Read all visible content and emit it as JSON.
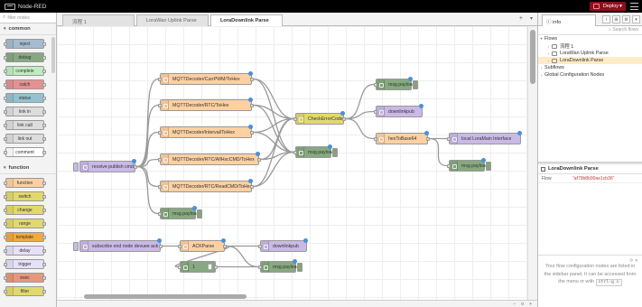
{
  "header": {
    "title": "Node-RED",
    "deploy_label": "Deploy"
  },
  "palette": {
    "filter_placeholder": "filter nodes",
    "categories": [
      {
        "label": "common",
        "nodes": [
          {
            "label": "inject",
            "color": "#a6bbcf"
          },
          {
            "label": "debug",
            "color": "#87a980"
          },
          {
            "label": "complete",
            "color": "#c0edc0"
          },
          {
            "label": "catch",
            "color": "#e49191"
          },
          {
            "label": "status",
            "color": "#94c1d0"
          },
          {
            "label": "link in",
            "color": "#dddddd"
          },
          {
            "label": "link call",
            "color": "#dddddd"
          },
          {
            "label": "link out",
            "color": "#dddddd"
          },
          {
            "label": "comment",
            "color": "#ffffff"
          }
        ]
      },
      {
        "label": "function",
        "nodes": [
          {
            "label": "function",
            "color": "#fdd0a2"
          },
          {
            "label": "switch",
            "color": "#e2d96e"
          },
          {
            "label": "change",
            "color": "#e2d96e"
          },
          {
            "label": "range",
            "color": "#e2d96e"
          },
          {
            "label": "template",
            "color": "#f2a93f"
          },
          {
            "label": "delay",
            "color": "#e6e0f8"
          },
          {
            "label": "trigger",
            "color": "#e6e0f8"
          },
          {
            "label": "exec",
            "color": "#e9967a"
          },
          {
            "label": "filter",
            "color": "#e2d96e"
          }
        ]
      }
    ]
  },
  "workspace": {
    "tabs": [
      {
        "label": "流程 1",
        "active": false
      },
      {
        "label": "LoraWan Uplink Parse",
        "active": false
      },
      {
        "label": "LoraDownlink Parse",
        "active": true
      }
    ],
    "nodes": [
      {
        "id": "recv",
        "label": "receive publish cmd",
        "color": "#c9b9e6"
      },
      {
        "id": "f1",
        "label": "MQTTDecoder/CurrPWM/ToHex",
        "color": "#fdd0a2"
      },
      {
        "id": "f2",
        "label": "MQTTDecoder/RTC/ToHex",
        "color": "#fdd0a2"
      },
      {
        "id": "f3",
        "label": "MQTTDecoder/Interval/ToHex",
        "color": "#fdd0a2"
      },
      {
        "id": "f4",
        "label": "MQTTDecoder/RTC/AlfHscCMD/ToHex",
        "color": "#fdd0a2"
      },
      {
        "id": "f5",
        "label": "MQTTDecoder/RTC/ReadCMD/ToHex",
        "color": "#fdd0a2"
      },
      {
        "id": "dbg1",
        "label": "msg.payload",
        "color": "#87a980"
      },
      {
        "id": "check",
        "label": "CheckErrorCode",
        "color": "#e2d96e"
      },
      {
        "id": "dbg2",
        "label": "msg.payload",
        "color": "#87a980"
      },
      {
        "id": "dbg3",
        "label": "msg.payload",
        "color": "#87a980"
      },
      {
        "id": "down",
        "label": "downlinkpub",
        "color": "#c9b9e6"
      },
      {
        "id": "hex",
        "label": "hexToBase64",
        "color": "#fdd0a2"
      },
      {
        "id": "local",
        "label": "local LoraMain Interface",
        "color": "#c9b9e6"
      },
      {
        "id": "dbg4",
        "label": "msg.payload",
        "color": "#87a980"
      },
      {
        "id": "sub",
        "label": "subscribe end node devuee ack",
        "color": "#c9b9e6"
      },
      {
        "id": "ack",
        "label": "ACKParse",
        "color": "#fdd0a2"
      },
      {
        "id": "dl2",
        "label": "downlinkpub",
        "color": "#c9b9e6"
      },
      {
        "id": "sw",
        "label": "1",
        "color": "#87a980"
      },
      {
        "id": "dbg5",
        "label": "msg.payload",
        "color": "#87a980"
      }
    ],
    "footer": {
      "zoom_out": "−",
      "zoom_reset": "o",
      "zoom_in": "+"
    }
  },
  "sidebar": {
    "tab_label": "info",
    "search_placeholder": "Search flows",
    "tree": {
      "flows_label": "Flows",
      "flows": [
        "流程 1",
        "LoraWan Uplink Parse",
        "LoraDownlink Parse"
      ],
      "subflows_label": "Subflows",
      "global_label": "Global Configuration Nodes"
    },
    "info": {
      "title": "LoraDownlink Parse",
      "flow_key": "Flow",
      "flow_value": "\"af79b8b90ae1cb36\""
    },
    "tip": {
      "text": "Your flow configuration nodes are listed in the sidebar panel. It can be accessed from the menu or with",
      "shortcut": "ctrl-g c"
    }
  }
}
